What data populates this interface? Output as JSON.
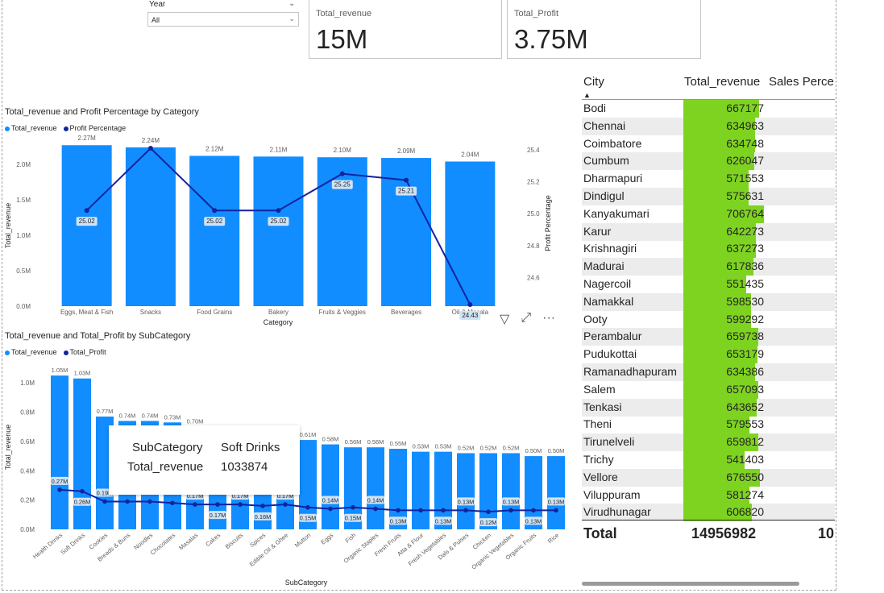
{
  "slicer": {
    "title": "Year",
    "value": "All"
  },
  "cards": [
    {
      "title": "Total_revenue",
      "value": "15M"
    },
    {
      "title": "Total_Profit",
      "value": "3.75M"
    }
  ],
  "chart1": {
    "title": "Total_revenue and Profit Percentage by Category",
    "legend": [
      "Total_revenue",
      "Profit Percentage"
    ]
  },
  "chart2": {
    "title": "Total_revenue and Total_Profit by SubCategory",
    "legend": [
      "Total_revenue",
      "Total_Profit"
    ]
  },
  "chart_data": [
    {
      "type": "bar",
      "title": "Total_revenue and Profit Percentage by Category",
      "xlabel": "Category",
      "ylabel": "Total_revenue",
      "y2label": "Profit Percentage",
      "categories": [
        "Eggs, Meat & Fish",
        "Snacks",
        "Food Grains",
        "Bakery",
        "Fruits & Veggies",
        "Beverages",
        "Oil & Masala"
      ],
      "series": [
        {
          "name": "Total_revenue",
          "values": [
            2270000,
            2240000,
            2120000,
            2110000,
            2100000,
            2090000,
            2040000
          ],
          "labels": [
            "2.27M",
            "2.24M",
            "2.12M",
            "2.11M",
            "2.10M",
            "2.09M",
            "2.04M"
          ]
        },
        {
          "name": "Profit Percentage",
          "values": [
            25.02,
            25.41,
            25.02,
            25.02,
            25.25,
            25.21,
            24.43
          ],
          "labels": [
            "25.02",
            "",
            "25.02",
            "25.02",
            "25.25",
            "25.21",
            "24.43"
          ]
        }
      ],
      "yticks": [
        "0.0M",
        "0.5M",
        "1.0M",
        "1.5M",
        "2.0M"
      ],
      "y2ticks": [
        "24.6",
        "24.8",
        "25.0",
        "25.2",
        "25.4"
      ],
      "ylim": [
        0,
        2250000
      ],
      "y2lim": [
        24.42,
        25.42
      ],
      "colors": {
        "bar": "#118dff",
        "line": "#12239e"
      }
    },
    {
      "type": "bar",
      "title": "Total_revenue and Total_Profit by SubCategory",
      "xlabel": "SubCategory",
      "ylabel": "Total_revenue",
      "categories": [
        "Health Drinks",
        "Soft Drinks",
        "Cookies",
        "Breads & Buns",
        "Noodles",
        "Chocolates",
        "Masalas",
        "Cakes",
        "Biscuits",
        "Spices",
        "Edible Oil & Ghee",
        "Mutton",
        "Eggs",
        "Fish",
        "Organic Staples",
        "Fresh Fruits",
        "Atta & Flour",
        "Fresh Vegetables",
        "Dals & Pulses",
        "Chicken",
        "Organic Vegetables",
        "Organic Fruits",
        "Rice"
      ],
      "series": [
        {
          "name": "Total_revenue",
          "values": [
            1050000,
            1030000,
            770000,
            740000,
            740000,
            730000,
            700000,
            690000,
            690000,
            660000,
            640000,
            610000,
            580000,
            560000,
            560000,
            550000,
            530000,
            530000,
            520000,
            520000,
            520000,
            500000,
            500000
          ],
          "labels": [
            "1.05M",
            "1.03M",
            "0.77M",
            "0.74M",
            "0.74M",
            "0.73M",
            "0.70M",
            "",
            "",
            "",
            "",
            "0.61M",
            "0.58M",
            "0.56M",
            "0.56M",
            "0.55M",
            "0.53M",
            "0.53M",
            "0.52M",
            "0.52M",
            "0.52M",
            "0.50M",
            "0.50M"
          ]
        },
        {
          "name": "Total_Profit",
          "values": [
            270000,
            260000,
            190000,
            190000,
            190000,
            180000,
            170000,
            170000,
            170000,
            160000,
            170000,
            150000,
            140000,
            150000,
            140000,
            130000,
            130000,
            130000,
            130000,
            120000,
            130000,
            130000,
            130000
          ],
          "labels": [
            "0.27M",
            "0.26M",
            "0.19M",
            "",
            "",
            "",
            "0.17M",
            "0.17M",
            "0.17M",
            "0.16M",
            "0.17M",
            "0.15M",
            "0.14M",
            "0.15M",
            "0.14M",
            "0.13M",
            "",
            "0.13M",
            "0.13M",
            "0.12M",
            "0.13M",
            "0.13M",
            "0.13M"
          ]
        }
      ],
      "yticks": [
        "0.0M",
        "0.2M",
        "0.4M",
        "0.6M",
        "0.8M",
        "1.0M"
      ],
      "ylim": [
        0,
        1100000
      ],
      "colors": {
        "bar": "#118dff",
        "line": "#12239e"
      }
    }
  ],
  "tooltip": {
    "k1": "SubCategory",
    "v1": "Soft Drinks",
    "k2": "Total_revenue",
    "v2": "1033874"
  },
  "table": {
    "headers": [
      "City",
      "Total_revenue",
      "Sales Perce"
    ],
    "rows": [
      {
        "city": "Bodi",
        "revenue": "667177",
        "value": 667177
      },
      {
        "city": "Chennai",
        "revenue": "634963",
        "value": 634963
      },
      {
        "city": "Coimbatore",
        "revenue": "634748",
        "value": 634748
      },
      {
        "city": "Cumbum",
        "revenue": "626047",
        "value": 626047
      },
      {
        "city": "Dharmapuri",
        "revenue": "571553",
        "value": 571553
      },
      {
        "city": "Dindigul",
        "revenue": "575631",
        "value": 575631
      },
      {
        "city": "Kanyakumari",
        "revenue": "706764",
        "value": 706764
      },
      {
        "city": "Karur",
        "revenue": "642273",
        "value": 642273
      },
      {
        "city": "Krishnagiri",
        "revenue": "637273",
        "value": 637273
      },
      {
        "city": "Madurai",
        "revenue": "617836",
        "value": 617836
      },
      {
        "city": "Nagercoil",
        "revenue": "551435",
        "value": 551435
      },
      {
        "city": "Namakkal",
        "revenue": "598530",
        "value": 598530
      },
      {
        "city": "Ooty",
        "revenue": "599292",
        "value": 599292
      },
      {
        "city": "Perambalur",
        "revenue": "659738",
        "value": 659738
      },
      {
        "city": "Pudukottai",
        "revenue": "653179",
        "value": 653179
      },
      {
        "city": "Ramanadhapuram",
        "revenue": "634386",
        "value": 634386
      },
      {
        "city": "Salem",
        "revenue": "657093",
        "value": 657093
      },
      {
        "city": "Tenkasi",
        "revenue": "643652",
        "value": 643652
      },
      {
        "city": "Theni",
        "revenue": "579553",
        "value": 579553
      },
      {
        "city": "Tirunelveli",
        "revenue": "659812",
        "value": 659812
      },
      {
        "city": "Trichy",
        "revenue": "541403",
        "value": 541403
      },
      {
        "city": "Vellore",
        "revenue": "676550",
        "value": 676550
      },
      {
        "city": "Viluppuram",
        "revenue": "581274",
        "value": 581274
      },
      {
        "city": "Virudhunagar",
        "revenue": "606820",
        "value": 606820
      }
    ],
    "total_label": "Total",
    "total_revenue": "14956982",
    "total_sales_pct": "10",
    "bar_color": "#7ed321"
  }
}
